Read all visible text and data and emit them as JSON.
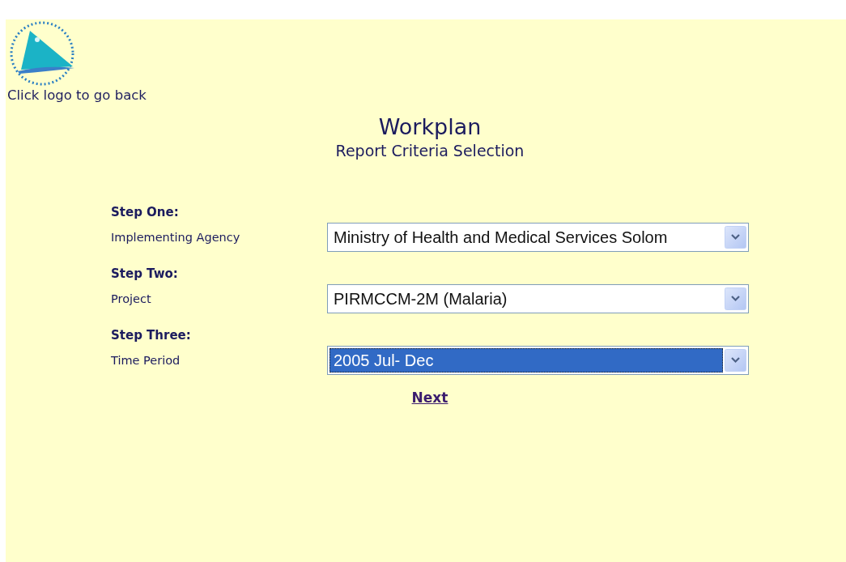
{
  "logo": {
    "caption": "Click logo to go back"
  },
  "header": {
    "title": "Workplan",
    "subtitle": "Report Criteria Selection"
  },
  "steps": [
    {
      "heading": "Step One:",
      "label": "Implementing Agency",
      "value": "Ministry of Health and Medical Services Solom",
      "focused": false
    },
    {
      "heading": "Step Two:",
      "label": "Project",
      "value": "PIRMCCM-2M (Malaria)",
      "focused": false
    },
    {
      "heading": "Step Three:",
      "label": "Time Period",
      "value": "2005 Jul- Dec",
      "focused": true
    }
  ],
  "next_link": "Next"
}
